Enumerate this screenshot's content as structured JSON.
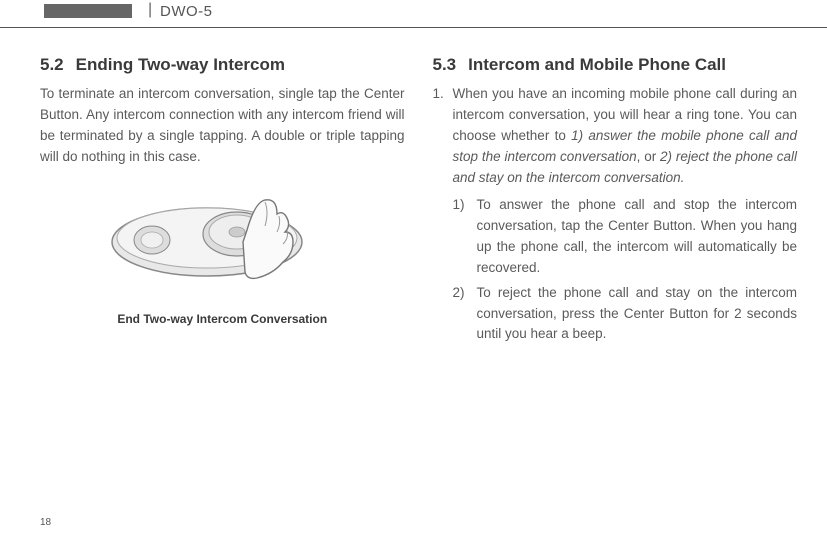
{
  "header": {
    "model": "DWO-5"
  },
  "page_number": "18",
  "left": {
    "sec_num": "5.2",
    "sec_title": "Ending Two-way Intercom",
    "para": "To terminate an intercom conversation, single tap the Center Button. Any intercom connection with any intercom friend will be terminated by a single tapping. A double or triple tapping will do nothing in this case.",
    "figure_alt": "device-with-finger-tap",
    "figure_caption": "End Two-way Intercom Conversation"
  },
  "right": {
    "sec_num": "5.3",
    "sec_title": "Intercom and Mobile Phone Call",
    "item1_num": "1.",
    "item1_lead": "When you have an incoming mobile phone call during an intercom conversation, you will hear a ring tone. You can choose whether to ",
    "item1_opt1": "1) answer the mobile phone call and stop the intercom conversation",
    "item1_mid": ", or ",
    "item1_opt2": "2) reject the phone call and stay on the intercom conversation.",
    "sub1_num": "1)",
    "sub1_text": "To answer the phone call and stop the intercom conversation, tap the Center Button. When you hang up the phone call, the intercom will automatically be recovered.",
    "sub2_num": "2)",
    "sub2_text": "To reject the phone call and stay on the intercom conversation, press the Center Button for 2 seconds until you hear a beep."
  }
}
